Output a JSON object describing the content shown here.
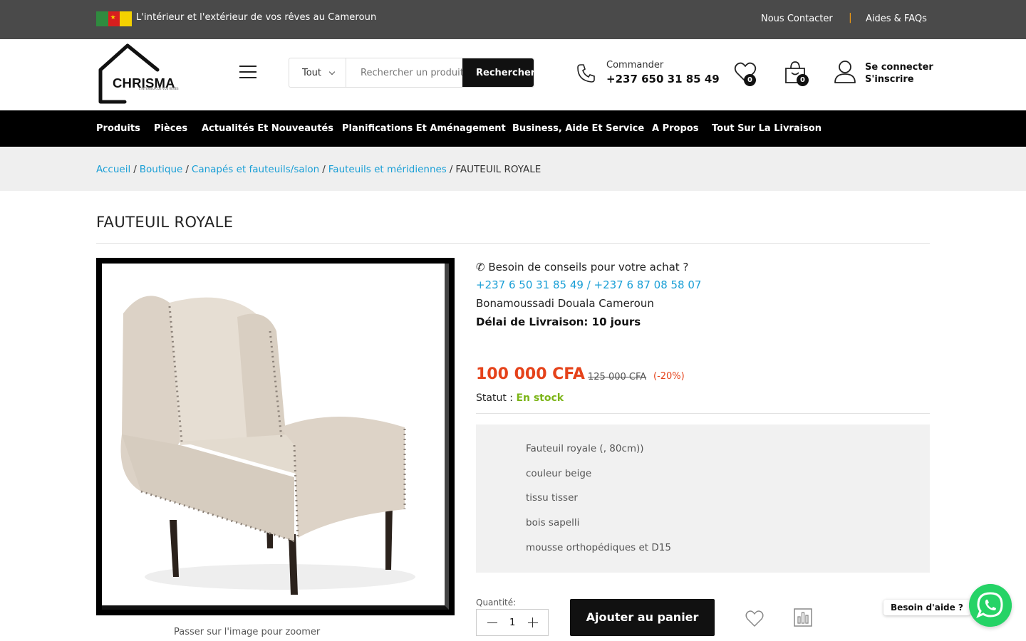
{
  "topbar": {
    "tagline": "L'intérieur et l'extérieur de vos rêves au Cameroun",
    "contact": "Nous Contacter",
    "separator": "|",
    "faq": "Aides & FAQs"
  },
  "header": {
    "logo_text": "CHRISMA",
    "logo_sub": "L'INTÉRIEUR DE VOS RÊVES",
    "search": {
      "category": "Tout",
      "placeholder": "Rechercher un produit...",
      "button": "Rechercher"
    },
    "order": {
      "label": "Commander",
      "phone": "+237 650 31 85 49"
    },
    "wishlist_count": "0",
    "cart_count": "0",
    "login": "Se connecter",
    "register": "S'inscrire"
  },
  "nav": [
    "Produits",
    "Pièces",
    "Actualités Et Nouveautés",
    "Planifications Et Aménagement",
    "Business, Aide Et Service",
    "A Propos",
    "Tout Sur La Livraison"
  ],
  "breadcrumb": {
    "links": [
      "Accueil",
      "Boutique",
      "Canapés et fauteuils/salon",
      "Fauteuils et méridiennes"
    ],
    "current": "FAUTEUIL ROYALE"
  },
  "product": {
    "title": "FAUTEUIL ROYALE",
    "zoom_hint": "Passer sur l'image pour zoomer",
    "advice": "Besoin de conseils pour votre achat ?",
    "phones": "+237 6 50 31 85 49 / +237 6 87 08 58 07",
    "address": "Bonamoussadi Douala Cameroun",
    "delay": "Délai de Livraison: 10 jours",
    "price": "100 000 CFA",
    "old_price": "125 000 CFA",
    "discount": "(-20%)",
    "status_label": "Statut :",
    "status_value": "En stock",
    "features": [
      "Fauteuil royale (, 80cm))",
      "couleur beige",
      "tissu tisser",
      "bois sapelli",
      "mousse orthopédiques et D15"
    ],
    "qty_label": "Quantité:",
    "qty_value": "1",
    "add_to_cart": "Ajouter au panier"
  },
  "help": {
    "label": "Besoin d'aide ?"
  },
  "colors": {
    "accent_blue": "#1a9fd6",
    "price_red": "#e5421a",
    "stock_green": "#7cb518",
    "whatsapp": "#25d366"
  }
}
